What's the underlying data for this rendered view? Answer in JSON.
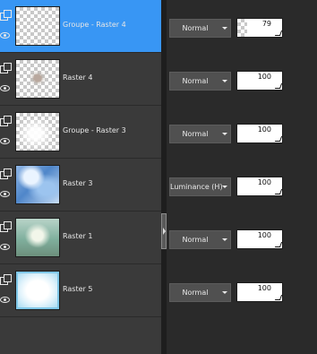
{
  "layers": [
    {
      "name": "Groupe - Raster 4",
      "is_group": true,
      "visible": true,
      "selected": true,
      "thumbnail": "transparent",
      "blend_mode": "Normal",
      "opacity": 79
    },
    {
      "name": "Raster 4",
      "is_group": false,
      "visible": true,
      "selected": false,
      "thumbnail": "figure-on-transparent",
      "blend_mode": "Normal",
      "opacity": 100
    },
    {
      "name": "Groupe - Raster 3",
      "is_group": true,
      "visible": true,
      "selected": false,
      "thumbnail": "white-glow",
      "blend_mode": "Normal",
      "opacity": 100
    },
    {
      "name": "Raster 3",
      "is_group": false,
      "visible": true,
      "selected": false,
      "thumbnail": "blue-abstract",
      "blend_mode": "Luminance (H)",
      "opacity": 100
    },
    {
      "name": "Raster 1",
      "is_group": false,
      "visible": true,
      "selected": false,
      "thumbnail": "green-landscape",
      "blend_mode": "Normal",
      "opacity": 100
    },
    {
      "name": "Raster 5",
      "is_group": false,
      "visible": true,
      "selected": false,
      "thumbnail": "white-frost-frame",
      "blend_mode": "Normal",
      "opacity": 100
    }
  ],
  "icons": {
    "group": "layer-group-icon",
    "visibility": "eye-icon",
    "dropdown": "chevron-down-icon",
    "splitter": "chevron-right-icon"
  },
  "colors": {
    "selected_row": "#3896f4",
    "panel": "#3a3a3a",
    "text": "#e6e6e6"
  }
}
